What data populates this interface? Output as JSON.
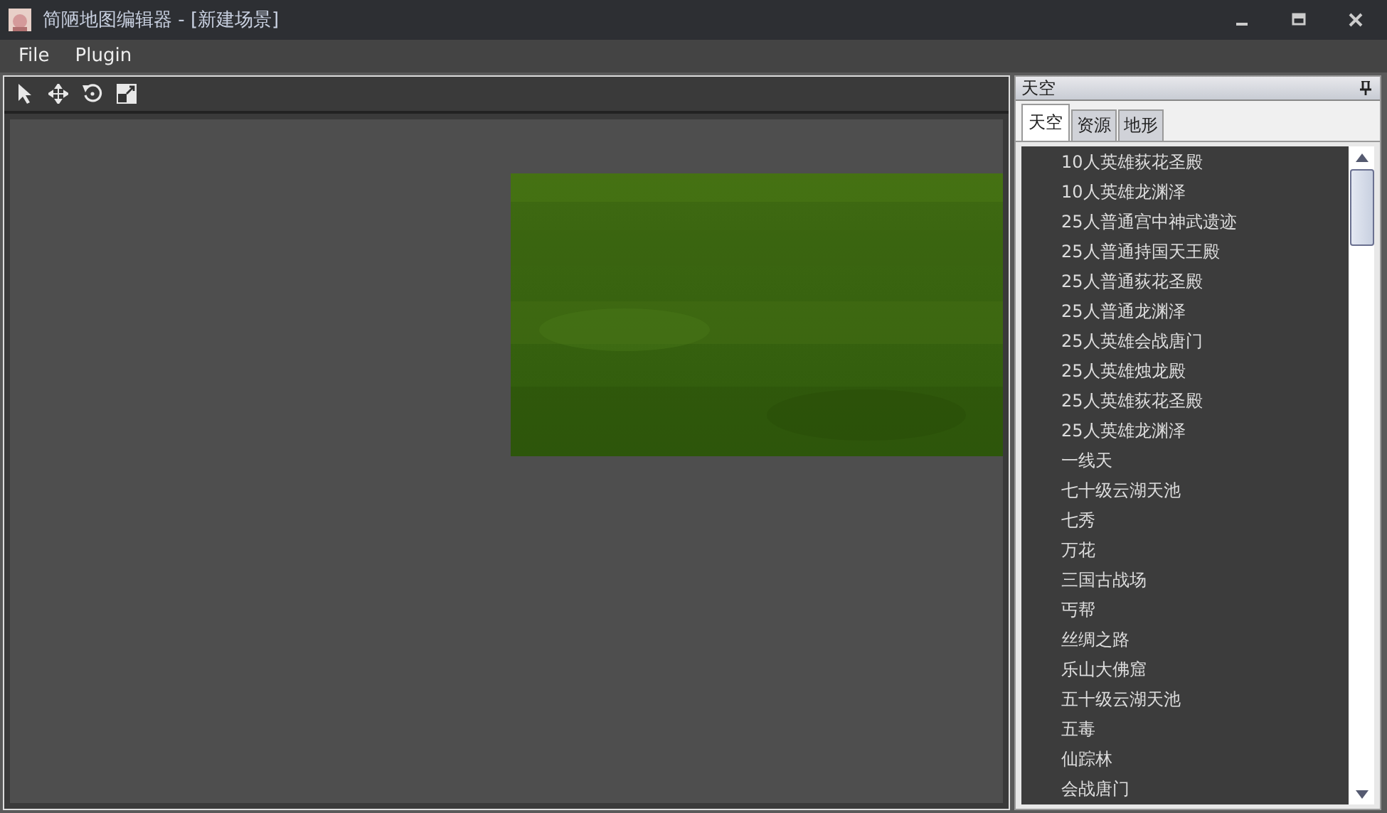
{
  "window": {
    "title": "简陋地图编辑器 - [新建场景]"
  },
  "menu": [
    "File",
    "Plugin"
  ],
  "viewport": {
    "kind": "picture"
  },
  "dock": {
    "title": "天空",
    "tabs": [
      {
        "label": "天空",
        "selected": true
      },
      {
        "label": "资源",
        "selected": false
      },
      {
        "label": "地形",
        "selected": false
      }
    ],
    "items": [
      "10人英雄荻花圣殿",
      "10人英雄龙渊泽",
      "25人普通宫中神武遗迹",
      "25人普通持国天王殿",
      "25人普通荻花圣殿",
      "25人普通龙渊泽",
      "25人英雄会战唐门",
      "25人英雄烛龙殿",
      "25人英雄荻花圣殿",
      "25人英雄龙渊泽",
      "一线天",
      "七十级云湖天池",
      "七秀",
      "万花",
      "三国古战场",
      "丐帮",
      "丝绸之路",
      "乐山大佛窟",
      "五十级云湖天池",
      "五毒",
      "仙踪林",
      "会战唐门"
    ]
  }
}
